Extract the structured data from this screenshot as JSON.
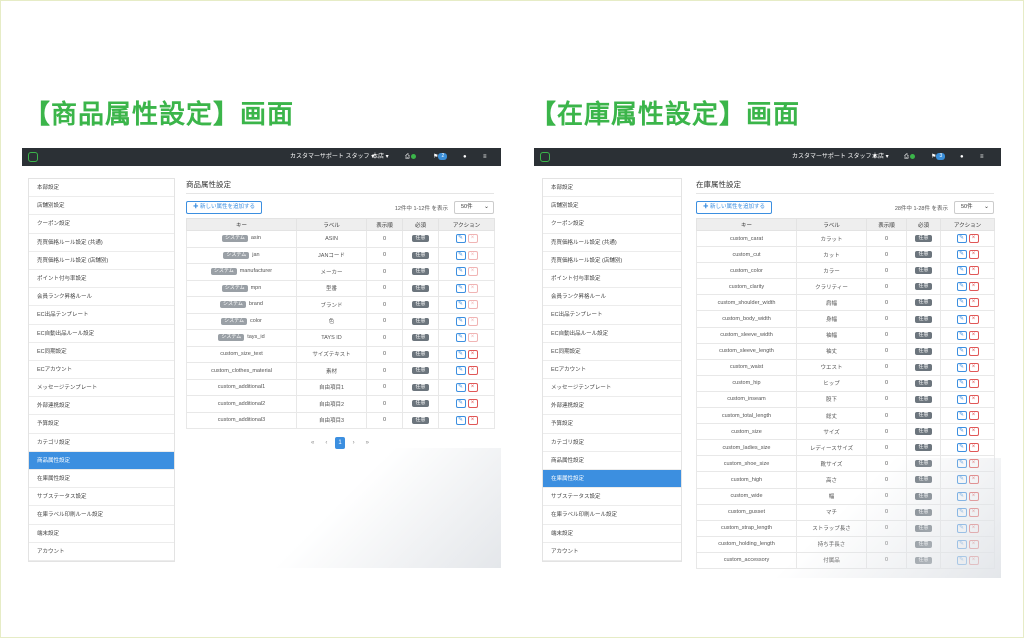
{
  "colors": {
    "brand_green": "#3bb54a",
    "accent_blue": "#3c8fe0",
    "topbar": "#2b3035",
    "delete_red": "#e05757"
  },
  "left_panel": {
    "heading": "【商品属性設定】画面",
    "topbar": {
      "user": "カスタマーサポート スタッフ",
      "store": "本店",
      "badge_count": "2"
    },
    "sidebar": [
      "本部設定",
      "店舗別設定",
      "クーポン設定",
      "売買価格ルール設定 (共通)",
      "売買価格ルール設定 (店舗別)",
      "ポイント付与率設定",
      "会員ランク昇格ルール",
      "EC出品テンプレート",
      "EC自動出品ルール設定",
      "EC同期設定",
      "ECアカウント",
      "メッセージテンプレート",
      "外部連携設定",
      "予算設定",
      "カテゴリ設定",
      "商品属性設定",
      "在庫属性設定",
      "サブステータス設定",
      "在庫ラベル印刷ルール設定",
      "端末設定",
      "アカウント"
    ],
    "active_index": 15,
    "page_title": "商品属性設定",
    "add_button": "新しい属性を追加する",
    "count_text": "12件中 1-12件 を表示",
    "per_page": "50件",
    "columns": [
      "キー",
      "ラベル",
      "表示順",
      "必須",
      "アクション"
    ],
    "system_badge": "システム",
    "required_badge": "任意",
    "rows": [
      {
        "key": "asin",
        "label": "ASIN",
        "order": "0",
        "system": true
      },
      {
        "key": "jan",
        "label": "JANコード",
        "order": "0",
        "system": true
      },
      {
        "key": "manufacturer",
        "label": "メーカー",
        "order": "0",
        "system": true
      },
      {
        "key": "mpn",
        "label": "型番",
        "order": "0",
        "system": true
      },
      {
        "key": "brand",
        "label": "ブランド",
        "order": "0",
        "system": true
      },
      {
        "key": "color",
        "label": "色",
        "order": "0",
        "system": true
      },
      {
        "key": "tays_id",
        "label": "TAYS ID",
        "order": "0",
        "system": true
      },
      {
        "key": "custom_size_text",
        "label": "サイズテキスト",
        "order": "0",
        "system": false
      },
      {
        "key": "custom_clothes_material",
        "label": "素材",
        "order": "0",
        "system": false
      },
      {
        "key": "custom_additional1",
        "label": "自由項目1",
        "order": "0",
        "system": false
      },
      {
        "key": "custom_additional2",
        "label": "自由項目2",
        "order": "0",
        "system": false
      },
      {
        "key": "custom_additional3",
        "label": "自由項目3",
        "order": "0",
        "system": false
      }
    ],
    "pagination": {
      "first": "«",
      "prev": "‹",
      "current": "1",
      "next": "›",
      "last": "»"
    }
  },
  "right_panel": {
    "heading": "【在庫属性設定】画面",
    "topbar": {
      "user": "カスタマーサポート スタッフ",
      "store": "本店",
      "badge_count": "3"
    },
    "sidebar": [
      "本部設定",
      "店舗別設定",
      "クーポン設定",
      "売買価格ルール設定 (共通)",
      "売買価格ルール設定 (店舗別)",
      "ポイント付与率設定",
      "会員ランク昇格ルール",
      "EC出品テンプレート",
      "EC自動出品ルール設定",
      "EC同期設定",
      "ECアカウント",
      "メッセージテンプレート",
      "外部連携設定",
      "予算設定",
      "カテゴリ設定",
      "商品属性設定",
      "在庫属性設定",
      "サブステータス設定",
      "在庫ラベル印刷ルール設定",
      "端末設定",
      "アカウント"
    ],
    "active_index": 16,
    "page_title": "在庫属性設定",
    "add_button": "新しい属性を追加する",
    "count_text": "28件中 1-28件 を表示",
    "per_page": "50件",
    "columns": [
      "キー",
      "ラベル",
      "表示順",
      "必須",
      "アクション"
    ],
    "required_badge": "任意",
    "rows": [
      {
        "key": "custom_carat",
        "label": "カラット",
        "order": "0"
      },
      {
        "key": "custom_cut",
        "label": "カット",
        "order": "0"
      },
      {
        "key": "custom_color",
        "label": "カラー",
        "order": "0"
      },
      {
        "key": "custom_clarity",
        "label": "クラリティー",
        "order": "0"
      },
      {
        "key": "custom_shoulder_width",
        "label": "肩幅",
        "order": "0"
      },
      {
        "key": "custom_body_width",
        "label": "身幅",
        "order": "0"
      },
      {
        "key": "custom_sleeve_width",
        "label": "袖幅",
        "order": "0"
      },
      {
        "key": "custom_sleeve_length",
        "label": "袖丈",
        "order": "0"
      },
      {
        "key": "custom_waist",
        "label": "ウエスト",
        "order": "0"
      },
      {
        "key": "custom_hip",
        "label": "ヒップ",
        "order": "0"
      },
      {
        "key": "custom_inseam",
        "label": "股下",
        "order": "0"
      },
      {
        "key": "custom_total_length",
        "label": "総丈",
        "order": "0"
      },
      {
        "key": "custom_size",
        "label": "サイズ",
        "order": "0"
      },
      {
        "key": "custom_ladies_size",
        "label": "レディースサイズ",
        "order": "0"
      },
      {
        "key": "custom_shoe_size",
        "label": "靴サイズ",
        "order": "0"
      },
      {
        "key": "custom_high",
        "label": "高さ",
        "order": "0"
      },
      {
        "key": "custom_wide",
        "label": "幅",
        "order": "0"
      },
      {
        "key": "custom_gusset",
        "label": "マチ",
        "order": "0"
      },
      {
        "key": "custom_strap_length",
        "label": "ストラップ長さ",
        "order": "0"
      },
      {
        "key": "custom_holding_length",
        "label": "持ち手長さ",
        "order": "0"
      },
      {
        "key": "custom_accessory",
        "label": "付属品",
        "order": "0"
      }
    ]
  }
}
